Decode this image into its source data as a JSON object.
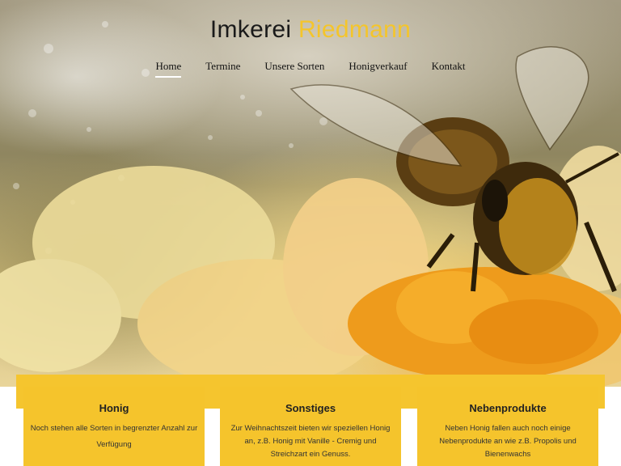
{
  "header": {
    "title_main": "Imkerei",
    "title_accent": "Riedmann"
  },
  "nav": {
    "items": [
      {
        "label": "Home",
        "active": true
      },
      {
        "label": "Termine",
        "active": false
      },
      {
        "label": "Unsere Sorten",
        "active": false
      },
      {
        "label": "Honigverkauf",
        "active": false
      },
      {
        "label": "Kontakt",
        "active": false
      }
    ]
  },
  "hero": {
    "image_subject": "bee-on-yellow-flower"
  },
  "cards": [
    {
      "title": "Honig",
      "text": "Noch stehen alle Sorten in begrenzter Anzahl zur Verfügung"
    },
    {
      "title": "Sonstiges",
      "text": "Zur Weihnachtszeit bieten wir speziellen Honig an, z.B. Honig mit Vanille - Cremig und Streichzart ein Genuss."
    },
    {
      "title": "Nebenprodukte",
      "text": "Neben Honig fallen auch noch einige Nebenprodukte an wie z.B. Propolis und Bienenwachs"
    }
  ],
  "colors": {
    "accent": "#f4c52b",
    "card_background": "#f5c42c",
    "text_dark": "#1a1a1a"
  }
}
